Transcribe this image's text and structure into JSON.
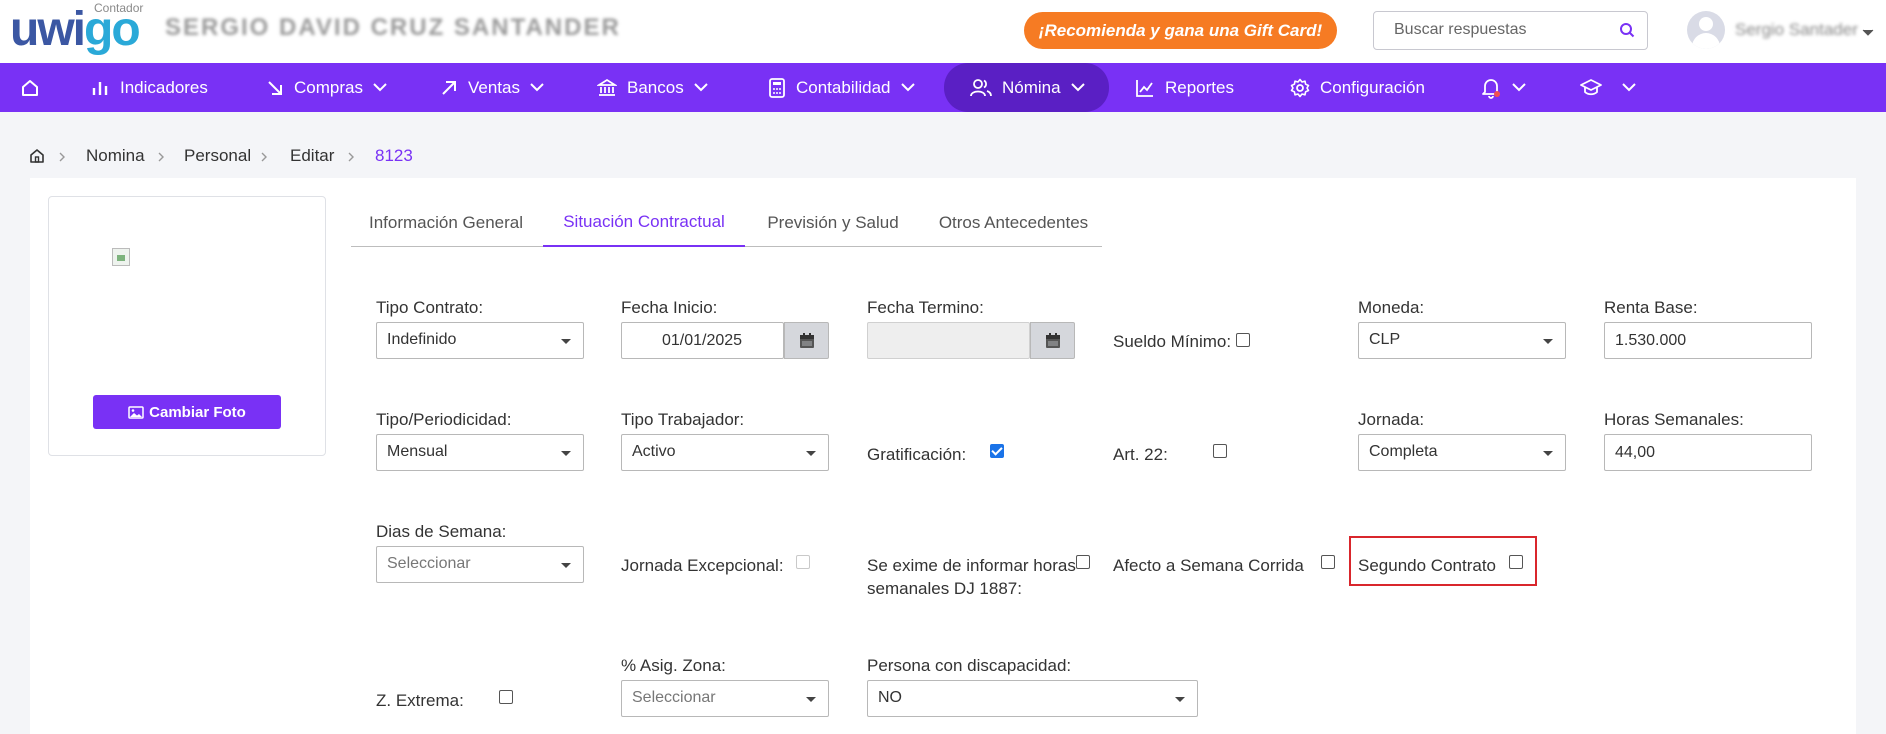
{
  "header": {
    "logo_text_a": "uwi",
    "logo_text_b": "go",
    "logo_sub": "Contador",
    "company_name": "SERGIO DAVID CRUZ SANTANDER",
    "promo_label": "¡Recomienda y gana una Gift Card!",
    "search_placeholder": "Buscar respuestas",
    "user_name": "Sergio Santader"
  },
  "nav": {
    "items": [
      {
        "label": "Indicadores"
      },
      {
        "label": "Compras"
      },
      {
        "label": "Ventas"
      },
      {
        "label": "Bancos"
      },
      {
        "label": "Contabilidad"
      },
      {
        "label": "Nómina"
      },
      {
        "label": "Reportes"
      },
      {
        "label": "Configuración"
      }
    ],
    "active": "Nómina"
  },
  "breadcrumb": {
    "items": [
      "Nomina",
      "Personal",
      "Editar",
      "8123"
    ]
  },
  "photo": {
    "button_label": "Cambiar Foto"
  },
  "tabs": [
    {
      "label": "Información General"
    },
    {
      "label": "Situación Contractual"
    },
    {
      "label": "Previsión y Salud"
    },
    {
      "label": "Otros Antecedentes"
    }
  ],
  "active_tab": "Situación Contractual",
  "form": {
    "tipo_contrato": {
      "label": "Tipo Contrato:",
      "value": "Indefinido"
    },
    "fecha_inicio": {
      "label": "Fecha Inicio:",
      "value": "01/01/2025"
    },
    "fecha_termino": {
      "label": "Fecha Termino:",
      "value": ""
    },
    "sueldo_minimo": {
      "label": "Sueldo Mínimo:",
      "checked": false
    },
    "moneda": {
      "label": "Moneda:",
      "value": "CLP"
    },
    "renta_base": {
      "label": "Renta Base:",
      "value": "1.530.000"
    },
    "tipo_periodicidad": {
      "label": "Tipo/Periodicidad:",
      "value": "Mensual"
    },
    "tipo_trabajador": {
      "label": "Tipo Trabajador:",
      "value": "Activo"
    },
    "gratificacion": {
      "label": "Gratificación:",
      "checked": true
    },
    "art22": {
      "label": "Art. 22:",
      "checked": false
    },
    "jornada": {
      "label": "Jornada:",
      "value": "Completa"
    },
    "horas_semanales": {
      "label": "Horas Semanales:",
      "value": "44,00"
    },
    "dias_semana": {
      "label": "Dias de Semana:",
      "placeholder": "Seleccionar"
    },
    "jornada_excepcional": {
      "label": "Jornada Excepcional:",
      "checked": false
    },
    "se_exime": {
      "label_line1": "Se exime de informar horas",
      "label_line2": "semanales DJ 1887:",
      "checked": false
    },
    "afecto_semana_corrida": {
      "label": "Afecto a Semana Corrida",
      "checked": false
    },
    "segundo_contrato": {
      "label": "Segundo Contrato",
      "checked": false
    },
    "z_extrema": {
      "label": "Z. Extrema:",
      "checked": false
    },
    "asig_zona": {
      "label": "% Asig. Zona:",
      "placeholder": "Seleccionar"
    },
    "discapacidad": {
      "label": "Persona con discapacidad:",
      "value": "NO"
    }
  },
  "colors": {
    "primary": "#7931f5",
    "promo": "#f67b23",
    "highlight": "#d9262c"
  }
}
